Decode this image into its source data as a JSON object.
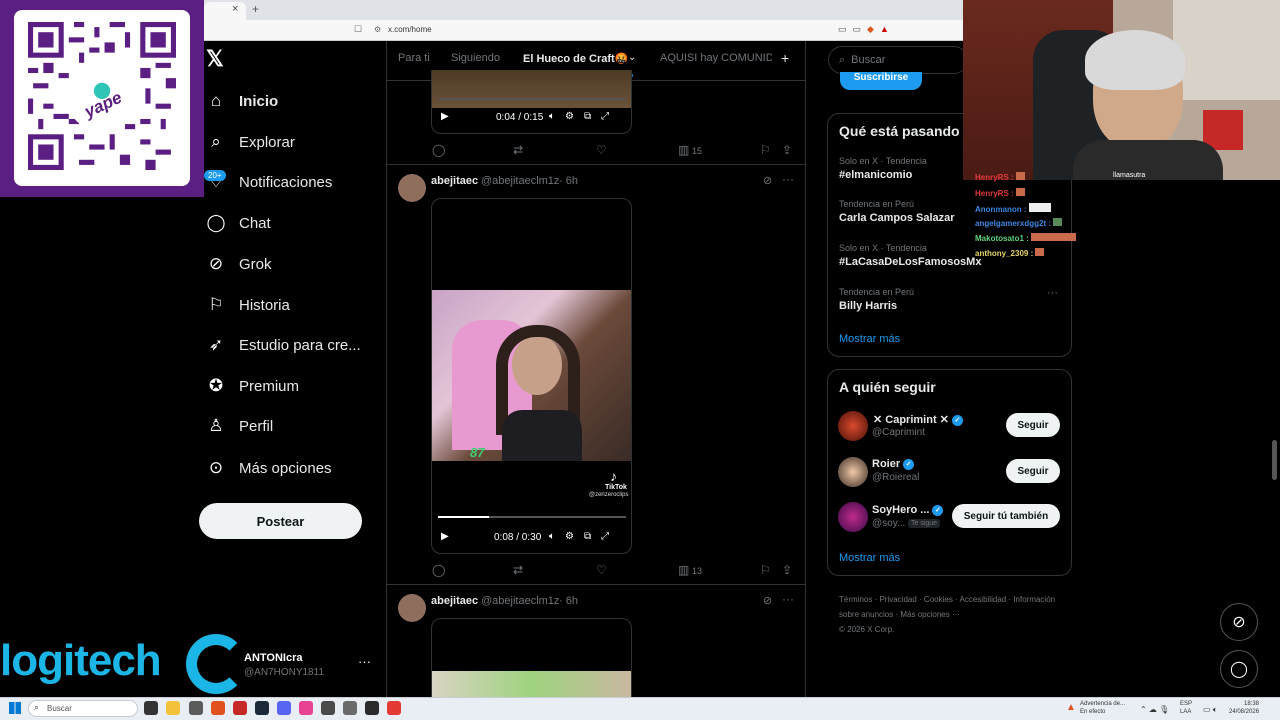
{
  "browser": {
    "url": "x.com/home",
    "tab_close": "×",
    "new_tab": "+"
  },
  "overlay_qr": {
    "brand": "yape",
    "currency": "S/"
  },
  "nav": {
    "items": [
      {
        "label": "Inicio",
        "icon": "home-icon",
        "bold": true
      },
      {
        "label": "Explorar",
        "icon": "search-icon"
      },
      {
        "label": "Notificaciones",
        "icon": "bell-icon"
      },
      {
        "label": "Chat",
        "icon": "chat-icon"
      },
      {
        "label": "Grok",
        "icon": "grok-icon"
      },
      {
        "label": "Historia",
        "icon": "bookmark-icon"
      },
      {
        "label": "Estudio para cre...",
        "icon": "rocket-icon"
      },
      {
        "label": "Premium",
        "icon": "verified-icon"
      },
      {
        "label": "Perfil",
        "icon": "person-icon"
      },
      {
        "label": "Más opciones",
        "icon": "more-circle-icon"
      }
    ],
    "notif_badge": "20+",
    "post_button": "Postear"
  },
  "profile": {
    "name": "ANTONIcra",
    "handle": "@AN7HONY1811",
    "more": "···"
  },
  "sponsor": {
    "logitech": "logitech"
  },
  "tabs": [
    {
      "label": "Para ti"
    },
    {
      "label": "Siguiendo"
    },
    {
      "label": "El Hueco de Craft🤬"
    },
    {
      "label": "AQUISI hay COMUNID"
    }
  ],
  "tab_add": "+",
  "tweets": [
    {
      "time_display": "0:04 / 0:15",
      "views": "15"
    },
    {
      "user": "abejitaec",
      "handle": "@abejitaeclm1z",
      "age": "· 6h",
      "time_display": "0:08 / 0:30",
      "views": "13",
      "progress": 0.27,
      "watermark_brand": "TikTok",
      "watermark_user": "@zenzeroclips",
      "overlay_number": "87"
    },
    {
      "user": "abejitaec",
      "handle": "@abejitaeclm1z",
      "age": "· 6h"
    }
  ],
  "right": {
    "search_placeholder": "Buscar",
    "subscribe": "Suscribirse",
    "trends_title": "Qué está pasando",
    "trends": [
      {
        "meta": "Solo en X · Tendencia",
        "name": "#elmanicomio"
      },
      {
        "meta": "Tendencia en Perú",
        "name": "Carla Campos Salazar"
      },
      {
        "meta": "Solo en X · Tendencia",
        "name": "#LaCasaDeLosFamososMx"
      },
      {
        "meta": "Tendencia en Perú",
        "name": "Billy Harris"
      }
    ],
    "trends_more": "Mostrar más",
    "follow_title": "A quién seguir",
    "follow": [
      {
        "name": "✕ Caprimint ✕",
        "handle": "@Caprimint",
        "button": "Seguir"
      },
      {
        "name": "Roier",
        "handle": "@Roiereal",
        "button": "Seguir"
      },
      {
        "name": "SoyHero ...",
        "handle": "@soy...",
        "badge": "Te sigue",
        "button": "Seguir tú también"
      }
    ],
    "follow_more": "Mostrar más",
    "footer": [
      "Términos",
      "Privacidad",
      "Cookies",
      "Accesibilidad",
      "Información sobre anuncios",
      "Más opciones ···",
      "© 2026 X Corp."
    ]
  },
  "stream_chat": [
    {
      "user": "HenryRS :",
      "color": "#e23b3b"
    },
    {
      "user": "HenryRS :",
      "color": "#e23b3b"
    },
    {
      "user": "Anonmanon :",
      "color": "#3b86e2"
    },
    {
      "user": "angelgamerxdgg2t :",
      "color": "#3b86e2"
    },
    {
      "user": "Makotosato1 :",
      "color": "#5ed37a"
    },
    {
      "user": "anthony_2309 :",
      "color": "#e8d36b"
    }
  ],
  "cam": {
    "name_tag": "llamasutra"
  },
  "taskbar": {
    "search": "Buscar",
    "warning_title": "Advertencia de...",
    "warning_sub": "En efecto",
    "lang_top": "ESP",
    "lang_bottom": "LAA",
    "time": "18:38",
    "date": "24/08/2026"
  }
}
